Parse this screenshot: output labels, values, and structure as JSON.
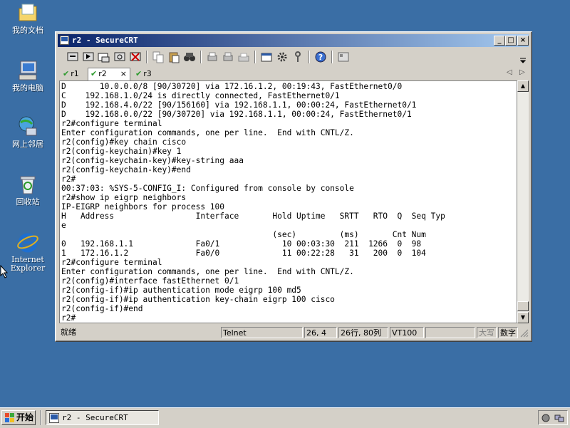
{
  "desktop": {
    "icons": [
      {
        "label": "我的文档",
        "icon": "my-documents-icon"
      },
      {
        "label": "我的电脑",
        "icon": "my-computer-icon"
      },
      {
        "label": "网上邻居",
        "icon": "network-places-icon"
      },
      {
        "label": "回收站",
        "icon": "recycle-bin-icon"
      },
      {
        "label": "Internet Explorer",
        "icon": "internet-explorer-icon"
      }
    ]
  },
  "window": {
    "title": "r2 - SecureCRT",
    "buttons": {
      "minimize": "_",
      "maximize": "□",
      "close": "×"
    }
  },
  "tabs": [
    {
      "label": "r1",
      "active": false
    },
    {
      "label": "r2",
      "active": true,
      "close": "×"
    },
    {
      "label": "r3",
      "active": false
    }
  ],
  "tab_nav": {
    "prev": "◁",
    "next": "▷"
  },
  "terminal": {
    "lines": [
      "D       10.0.0.0/8 [90/30720] via 172.16.1.2, 00:19:43, FastEthernet0/0",
      "C    192.168.1.0/24 is directly connected, FastEthernet0/1",
      "D    192.168.4.0/22 [90/156160] via 192.168.1.1, 00:00:24, FastEthernet0/1",
      "D    192.168.0.0/22 [90/30720] via 192.168.1.1, 00:00:24, FastEthernet0/1",
      "r2#configure terminal",
      "Enter configuration commands, one per line.  End with CNTL/Z.",
      "r2(config)#key chain cisco",
      "r2(config-keychain)#key 1",
      "r2(config-keychain-key)#key-string aaa",
      "r2(config-keychain-key)#end",
      "r2#",
      "00:37:03: %SYS-5-CONFIG_I: Configured from console by console",
      "r2#show ip eigrp neighbors",
      "IP-EIGRP neighbors for process 100",
      "H   Address                 Interface       Hold Uptime   SRTT   RTO  Q  Seq Typ",
      "e",
      "                                            (sec)         (ms)       Cnt Num",
      "0   192.168.1.1             Fa0/1             10 00:03:30  211  1266  0  98",
      "1   172.16.1.2              Fa0/0             11 00:22:28   31   200  0  104",
      "r2#configure terminal",
      "Enter configuration commands, one per line.  End with CNTL/Z.",
      "r2(config)#interface fastEthernet 0/1",
      "r2(config-if)#ip authentication mode eigrp 100 md5",
      "r2(config-if)#ip authentication key-chain eigrp 100 cisco",
      "r2(config-if)#end",
      "r2#"
    ]
  },
  "statusbar": {
    "ready": "就绪",
    "protocol": "Telnet",
    "cursor": "26, 4",
    "size": "26行, 80列",
    "emulation": "VT100",
    "caps": "大写",
    "num": "数字"
  },
  "taskbar": {
    "start_label": "开始",
    "task_label": "r2 - SecureCRT"
  }
}
